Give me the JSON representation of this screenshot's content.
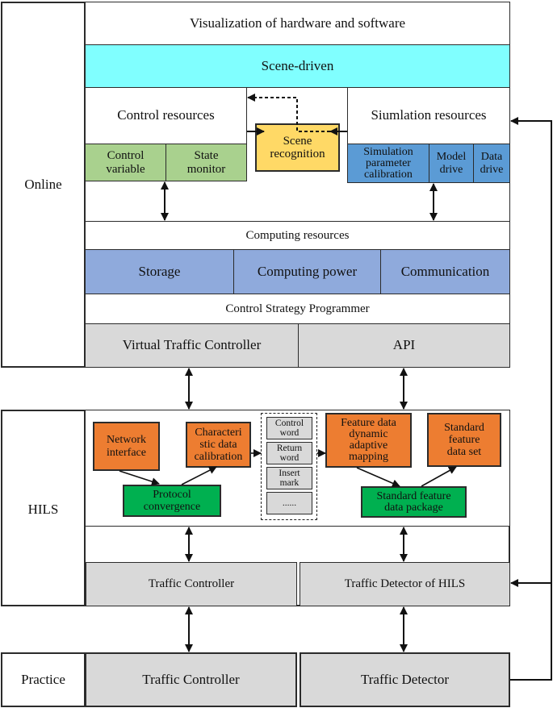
{
  "layers": {
    "online": "Online",
    "hils": "HILS",
    "practice": "Practice"
  },
  "online": {
    "visualization": "Visualization of hardware and software",
    "scene_driven": "Scene-driven",
    "control_resources": {
      "title": "Control resources",
      "cells": [
        "Control\nvariable",
        "State\nmonitor"
      ]
    },
    "scene_recognition": "Scene\nrecognition",
    "simulation_resources": {
      "title": "Siumlation  resources",
      "cells": [
        "Simulation\nparameter\ncalibration",
        "Model\ndrive",
        "Data\ndrive"
      ]
    },
    "computing_resources": {
      "title": "Computing resources",
      "cells": [
        "Storage",
        "Computing power",
        "Communication"
      ]
    },
    "control_strategy_programmer": "Control Strategy Programmer",
    "virtual_traffic_controller": "Virtual Traffic Controller",
    "api": "API"
  },
  "hils": {
    "network_interface": "Network\ninterface",
    "characteristic_data_calibration": "Characteri\nstic data\ncalibration",
    "protocol_convergence": "Protocol\nconvergence",
    "frame_fields": [
      "Control\nword",
      "Return\nword",
      "Insert\nmark",
      "......"
    ],
    "feature_data_mapping": "Feature data\ndynamic\nadaptive\nmapping",
    "standard_feature_data_set": "Standard\nfeature\ndata set",
    "standard_feature_data_package": "Standard feature\ndata package",
    "traffic_controller": "Traffic Controller",
    "traffic_detector": "Traffic Detector of HILS"
  },
  "practice": {
    "traffic_controller": "Traffic Controller",
    "traffic_detector": "Traffic Detector"
  },
  "colors": {
    "scene_driven": "#80ffff",
    "control_cells": "#a9d18e",
    "scene_recognition": "#ffd966",
    "simulation_cells": "#5b9bd5",
    "computing_cells": "#8faadc",
    "device_boxes": "#d9d9d9",
    "hils_process": "#ed7d31",
    "hils_output": "#00b050"
  }
}
